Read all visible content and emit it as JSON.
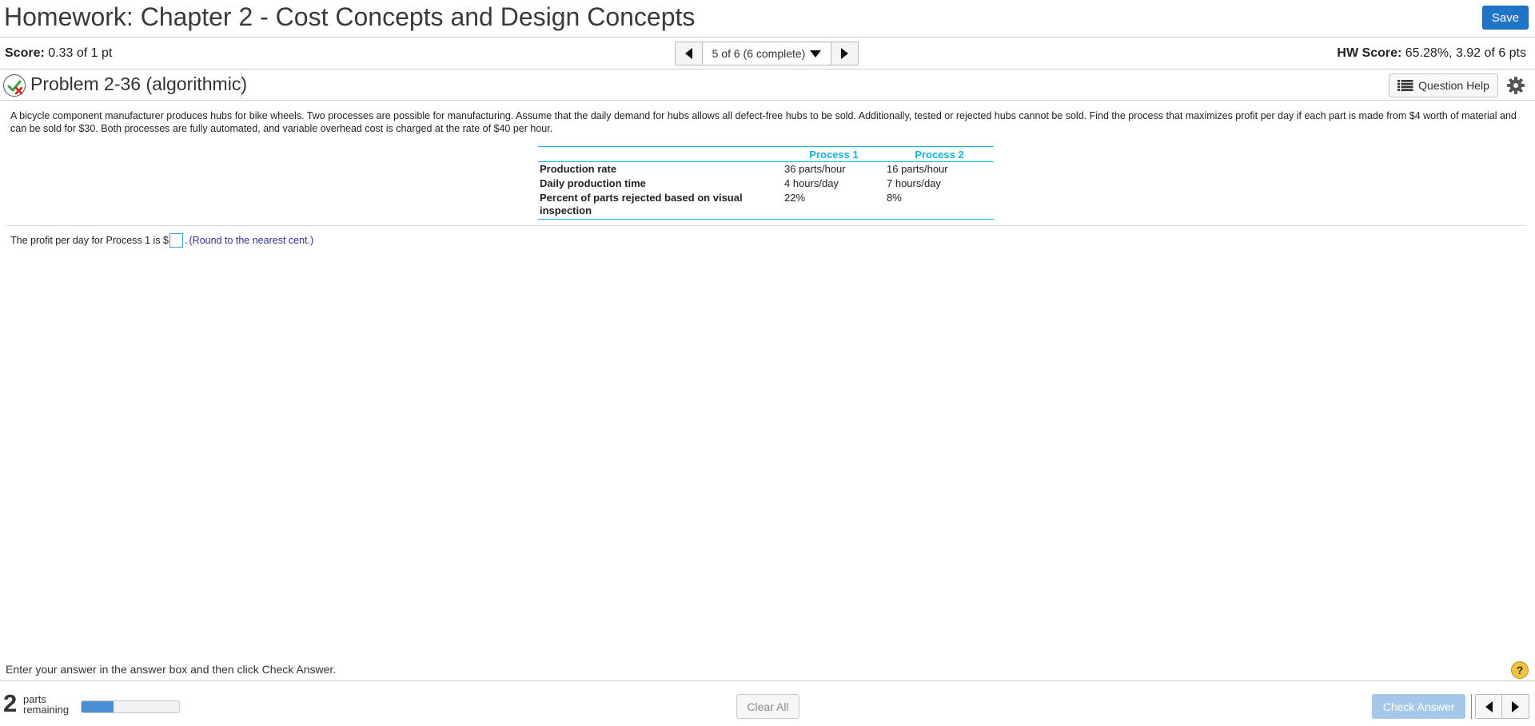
{
  "header": {
    "title": "Homework: Chapter 2 - Cost Concepts and Design Concepts",
    "save_label": "Save"
  },
  "score_bar": {
    "score_label": "Score:",
    "score_value": "0.33 of 1 pt",
    "question_selector": "5 of 6 (6 complete)",
    "hw_score_label": "HW Score:",
    "hw_score_value": "65.28%, 3.92 of 6 pts"
  },
  "problem": {
    "title": "Problem 2-36 (algorithmic)",
    "help_label": "Question Help",
    "text": "A bicycle component manufacturer produces hubs for bike wheels. Two processes are possible for manufacturing. Assume that the daily demand for hubs allows all defect-free hubs to be sold. Additionally, tested or rejected hubs cannot be sold. Find the process that maximizes profit per day if each part is made from $4 worth of material and can be sold for $30. Both processes are fully automated, and variable overhead cost is charged at the rate of $40 per hour."
  },
  "table": {
    "headers": [
      "",
      "Process 1",
      "Process 2"
    ],
    "rows": [
      {
        "label": "Production rate",
        "p1": "36 parts/hour",
        "p2": "16 parts/hour"
      },
      {
        "label": "Daily production time",
        "p1": "4 hours/day",
        "p2": "7 hours/day"
      },
      {
        "label": "Percent of parts rejected based on visual inspection",
        "p1": "22%",
        "p2": "8%"
      }
    ]
  },
  "answer": {
    "prefix": "The profit per day for Process 1 is $",
    "suffix": ".",
    "note": "(Round to the nearest cent.)",
    "value": ""
  },
  "footer": {
    "instruction": "Enter your answer in the answer box and then click Check Answer.",
    "help_glyph": "?",
    "parts_count": "2",
    "parts_line1": "parts",
    "parts_line2": "remaining",
    "progress_fraction": 0.33,
    "clear_label": "Clear All",
    "check_label": "Check Answer"
  },
  "colors": {
    "accent_blue": "#1f74c8",
    "table_cyan": "#13b4dc",
    "note_navy": "#2c2c9c",
    "check_disabled": "#a4c8e8"
  }
}
